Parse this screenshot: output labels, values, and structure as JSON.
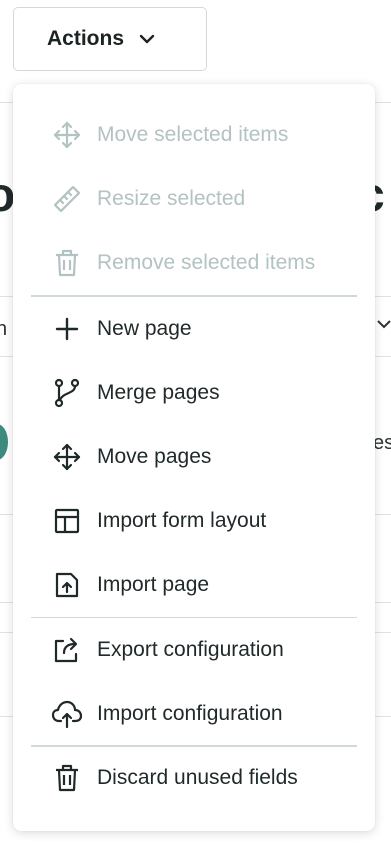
{
  "actions_button": {
    "label": "Actions",
    "icon": "chevron-down-icon"
  },
  "menu": {
    "group_selection": [
      {
        "label": "Move selected items",
        "icon": "move-arrows-icon",
        "disabled": true
      },
      {
        "label": "Resize selected",
        "icon": "ruler-icon",
        "disabled": true
      },
      {
        "label": "Remove selected items",
        "icon": "trash-icon",
        "disabled": true
      }
    ],
    "group_pages": [
      {
        "label": "New page",
        "icon": "plus-icon"
      },
      {
        "label": "Merge pages",
        "icon": "merge-branch-icon"
      },
      {
        "label": "Move pages",
        "icon": "move-arrows-icon"
      },
      {
        "label": "Import form layout",
        "icon": "layout-icon"
      },
      {
        "label": "Import page",
        "icon": "file-upload-icon"
      }
    ],
    "group_config": [
      {
        "label": "Export configuration",
        "icon": "export-icon"
      },
      {
        "label": "Import configuration",
        "icon": "cloud-upload-icon"
      }
    ],
    "group_cleanup": [
      {
        "label": "Discard unused fields",
        "icon": "trash-icon"
      }
    ]
  },
  "colors": {
    "enabled_text": "#1f2929",
    "disabled_text": "#b3c2c2",
    "avatar": "#3b8c7f",
    "divider": "#d0d8d8"
  }
}
